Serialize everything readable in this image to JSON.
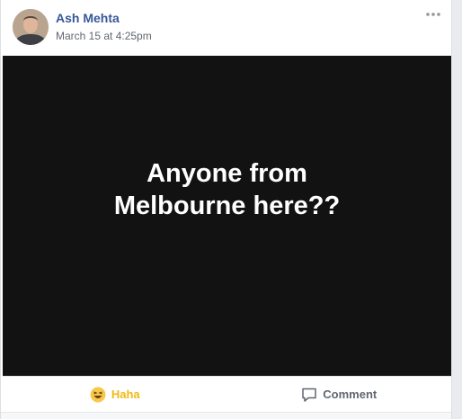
{
  "post": {
    "author": "Ash Mehta",
    "timestamp": "March 15 at 4:25pm",
    "image_text": "Anyone from Melbourne here??",
    "more_icon": "ellipsis-icon"
  },
  "actions": {
    "reaction_label": "Haha",
    "reaction_icon": "haha-emoji-icon",
    "comment_label": "Comment",
    "comment_icon": "comment-bubble-icon"
  },
  "colors": {
    "author_link": "#365899",
    "haha_accent": "#f0ba15",
    "media_background": "#121212"
  }
}
